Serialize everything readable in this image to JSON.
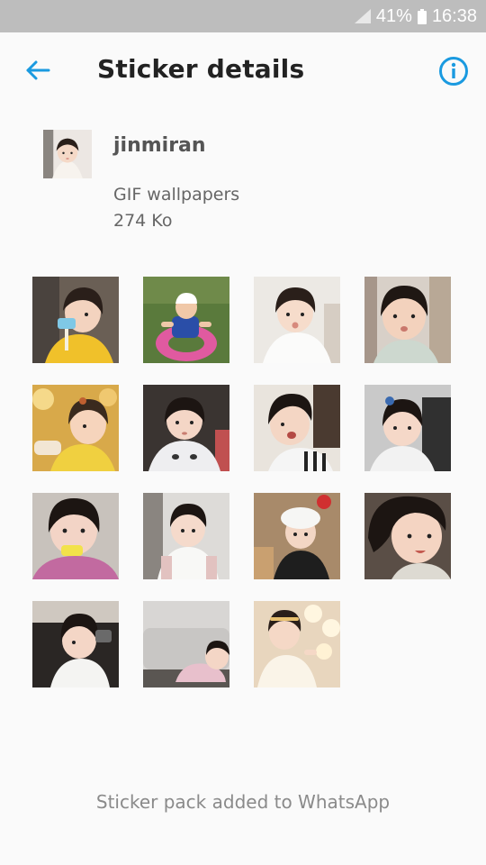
{
  "status_bar": {
    "battery": "41%",
    "time": "16:38"
  },
  "header": {
    "title": "Sticker details"
  },
  "pack": {
    "name": "jinmiran",
    "publisher": "GIF wallpapers",
    "size": "274 Ko"
  },
  "stickers_count": 15,
  "footer": {
    "status": "Sticker pack added to WhatsApp"
  },
  "colors": {
    "accent": "#1a9ae0",
    "status_bar": "#bdbdbd",
    "background": "#fafafa"
  }
}
